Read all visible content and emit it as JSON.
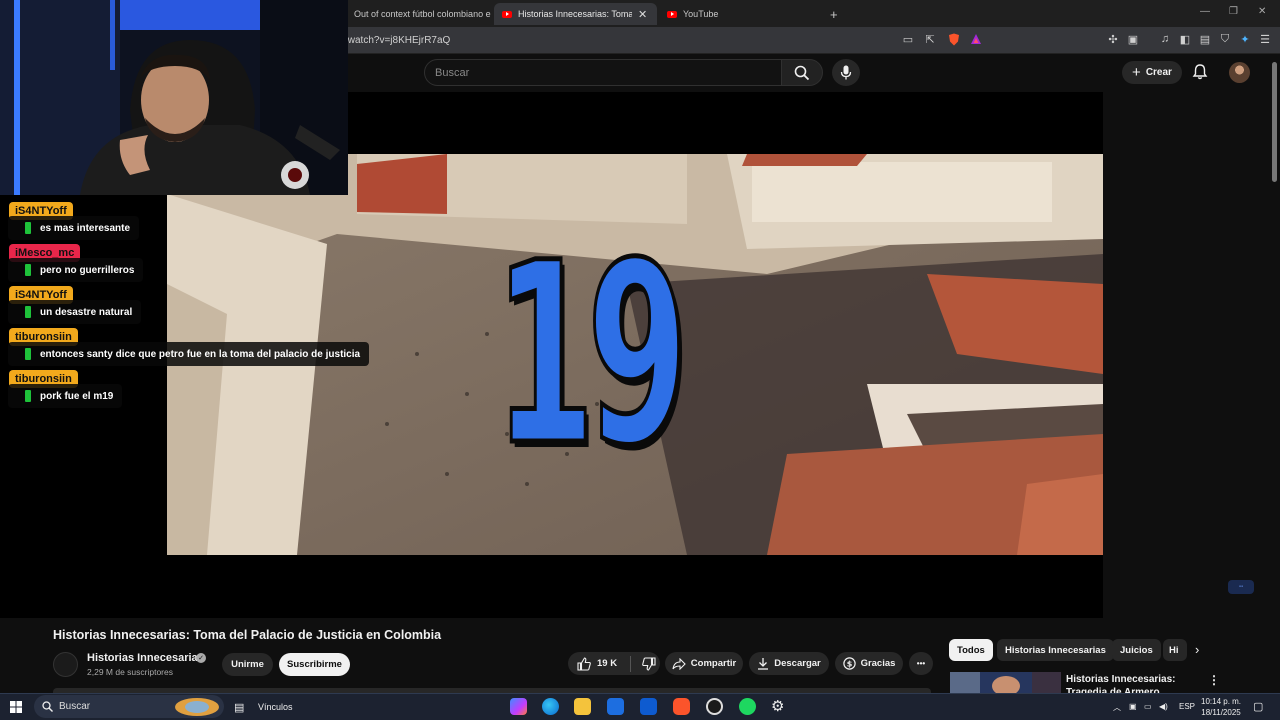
{
  "browser": {
    "tabs": [
      {
        "label": "Out of context fútbol colombiano en",
        "active": false
      },
      {
        "label": "Historias Innecesarias: Toma del",
        "active": true
      },
      {
        "label": "YouTube",
        "active": false
      }
    ],
    "new_tab": "+",
    "url": "/watch?v=j8KHEjrR7aQ"
  },
  "youtube": {
    "search_placeholder": "Buscar",
    "create_label": "Crear"
  },
  "video": {
    "overlay_number": "19",
    "title": "Historias Innecesarias: Toma del Palacio de Justicia en Colombia",
    "channel_name": "Historias Innecesarias",
    "subscribers": "2,29 M de suscriptores",
    "join_label": "Unirme",
    "subscribe_label": "Suscribirme",
    "likes": "19 K",
    "share_label": "Compartir",
    "download_label": "Descargar",
    "thanks_label": "Gracias",
    "more_label": "•••"
  },
  "chat": [
    {
      "user": "iS4NTYoff",
      "color": "#f2a91c",
      "message": "es mas interesante"
    },
    {
      "user": "iMesco_mc",
      "color": "#e8264a",
      "message": "pero no guerrilleros"
    },
    {
      "user": "iS4NTYoff",
      "color": "#f2a91c",
      "message": "un desastre natural"
    },
    {
      "user": "tiburonsiin",
      "color": "#f2a91c",
      "message": "entonces santy dice que petro fue en la toma del palacio de justicia"
    },
    {
      "user": "tiburonsiin",
      "color": "#f2a91c",
      "message": "pork fue el m19"
    }
  ],
  "sidebar": {
    "chips": [
      "Todos",
      "Historias Innecesarias",
      "Juicios",
      "Hi"
    ],
    "recommendation_title": "Historias Innecesarias: Tragedia de Armero"
  },
  "taskbar": {
    "search_label": "Buscar",
    "links_label": "Vínculos",
    "language": "ESP",
    "time": "10:14 p. m.",
    "date": "18/11/2025"
  }
}
